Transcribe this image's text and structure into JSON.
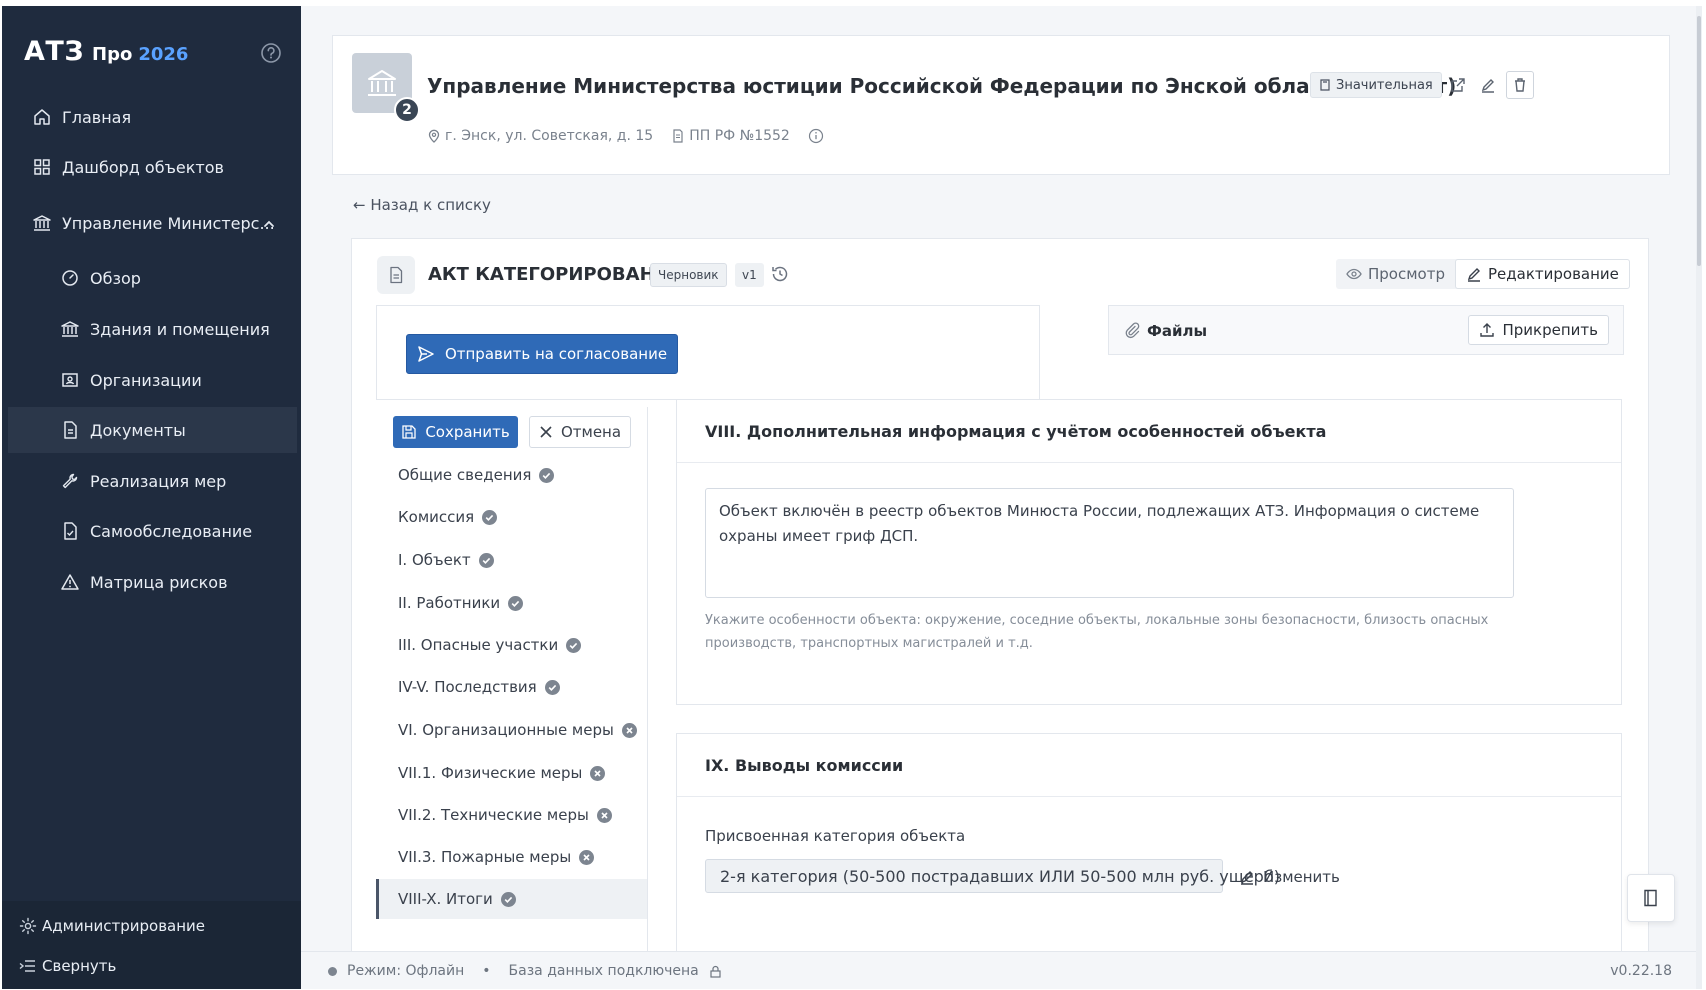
{
  "brand": {
    "name": "АТЗ",
    "edition": "Про",
    "year": "2026"
  },
  "sidebar": {
    "items": [
      {
        "label": "Главная",
        "icon": "home-icon"
      },
      {
        "label": "Дашборд объектов",
        "icon": "grid-icon"
      },
      {
        "label": "Управление Министерс...",
        "icon": "bank-icon"
      },
      {
        "label": "Обзор",
        "icon": "gauge-icon"
      },
      {
        "label": "Здания и помещения",
        "icon": "bank-icon"
      },
      {
        "label": "Организации",
        "icon": "id-card-icon"
      },
      {
        "label": "Документы",
        "icon": "document-icon"
      },
      {
        "label": "Реализация мер",
        "icon": "wrench-icon"
      },
      {
        "label": "Самообследование",
        "icon": "checklist-icon"
      },
      {
        "label": "Матрица рисков",
        "icon": "warning-icon"
      }
    ],
    "active": "Документы",
    "admin_label": "Администрирование",
    "collapse_label": "Свернуть"
  },
  "header": {
    "object_title": "Управление Министерства юстиции Российской Федерации по Энской области (импорт)",
    "badge_count": "2",
    "significance_tag": "Значительная",
    "address": "г. Энск, ул. Советская, д. 15",
    "regulation": "ПП РФ №1552"
  },
  "back_link": "← Назад к списку",
  "act": {
    "title": "АКТ КАТЕГОРИРОВАНИЯ",
    "status": "Черновик",
    "version": "v1",
    "view_label": "Просмотр",
    "edit_label": "Редактирование",
    "send_label": "Отправить на согласование",
    "files_label": "Файлы",
    "attach_label": "Прикрепить",
    "save_label": "Сохранить",
    "cancel_label": "Отмена"
  },
  "sections": [
    {
      "label": "Общие сведения",
      "status": "done"
    },
    {
      "label": "Комиссия",
      "status": "done"
    },
    {
      "label": "I. Объект",
      "status": "done"
    },
    {
      "label": "II. Работники",
      "status": "done"
    },
    {
      "label": "III. Опасные участки",
      "status": "done"
    },
    {
      "label": "IV-V. Последствия",
      "status": "done"
    },
    {
      "label": "VI. Организационные меры",
      "status": "incomplete"
    },
    {
      "label": "VII.1. Физические меры",
      "status": "incomplete"
    },
    {
      "label": "VII.2. Технические меры",
      "status": "incomplete"
    },
    {
      "label": "VII.3. Пожарные меры",
      "status": "incomplete"
    },
    {
      "label": "VIII-X. Итоги",
      "status": "done"
    }
  ],
  "block8": {
    "title": "VIII. Дополнительная информация с учётом особенностей объекта",
    "text": "Объект включён в реестр объектов Минюста России, подлежащих АТЗ. Информация о системе охраны имеет гриф ДСП.",
    "hint": "Укажите особенности объекта: окружение, соседние объекты, локальные зоны безопасности, близость опасных производств, транспортных магистралей и т.д."
  },
  "block9": {
    "title": "IX. Выводы комиссии",
    "field_label": "Присвоенная категория объекта",
    "field_value": "2-я категория (50-500 пострадавших ИЛИ 50-500 млн руб. ущерб)",
    "change_label": "Изменить"
  },
  "status_bar": {
    "mode": "Режим: Офлайн",
    "separator": "•",
    "db": "База данных подключена",
    "version": "v0.22.18"
  },
  "colors": {
    "sidebar_bg": "#1f2b3e",
    "primary": "#2f6ab7",
    "accent_year": "#5aa2ff"
  }
}
